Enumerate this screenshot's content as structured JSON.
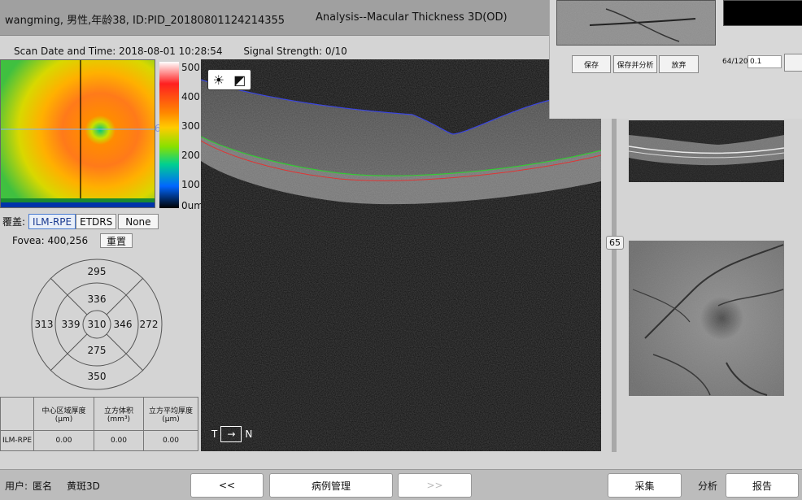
{
  "header": {
    "patient": "wangming, 男性,年龄38, ID:PID_20180801124214355",
    "analysis": "Analysis--Macular Thickness 3D(OD)"
  },
  "scan": {
    "date_label": "Scan Date and Time: 2018-08-01 10:28:54",
    "signal_label": "Signal Strength: 0/10"
  },
  "thickness_map": {
    "marker": "65",
    "scale": [
      "500",
      "400",
      "300",
      "200",
      "100",
      "0um"
    ]
  },
  "overlay": {
    "label": "覆盖:",
    "options": [
      "ILM-RPE",
      "ETDRS",
      "None"
    ],
    "selected": "ILM-RPE"
  },
  "fovea": {
    "label": "Fovea: 400,256",
    "reset_label": "重置"
  },
  "etdrs": {
    "outer_top": "295",
    "inner_top": "336",
    "outer_left": "313",
    "inner_left": "339",
    "center": "310",
    "inner_right": "346",
    "outer_right": "272",
    "inner_bottom": "275",
    "outer_bottom": "350"
  },
  "table": {
    "headers": [
      "中心区域厚度\n(μm)",
      "立方体积\n(mm³)",
      "立方平均厚度\n(μm)"
    ],
    "row_label": "ILM-RPE",
    "values": [
      "0.00",
      "0.00",
      "0.00"
    ]
  },
  "oct": {
    "orientation_left": "T",
    "orientation_right": "N"
  },
  "slider": {
    "value": "65"
  },
  "popup": {
    "buttons": [
      "保存",
      "保存并分析",
      "放弃"
    ],
    "counter": "64/120",
    "value": "0.1"
  },
  "bottom": {
    "user_label": "用户:",
    "user_name": "匿名",
    "mode": "黄斑3D",
    "prev": "<<",
    "case": "病例管理",
    "next": ">>",
    "capture": "采集",
    "analysis": "分析",
    "report": "报告"
  },
  "colors": {
    "ilm_line": "#3b46e0",
    "rpe_line1": "#35c835",
    "rpe_line2": "#e03535"
  }
}
